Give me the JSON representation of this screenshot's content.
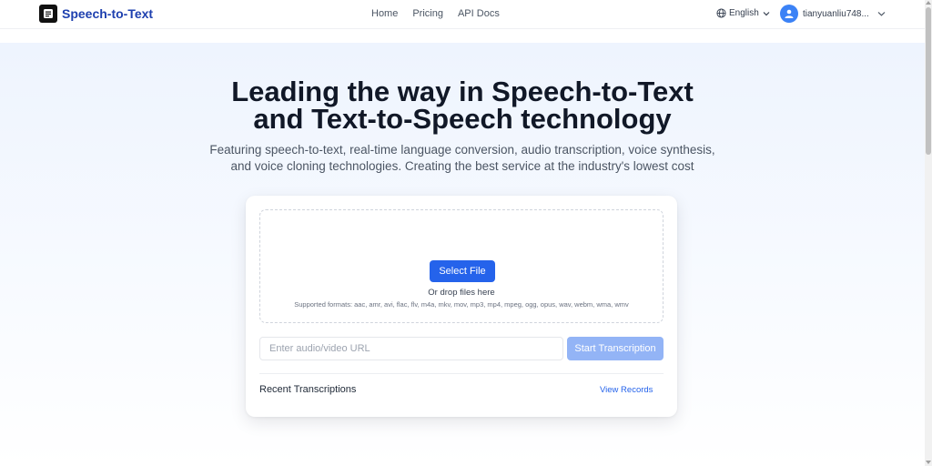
{
  "header": {
    "brand": "Speech-to-Text",
    "nav": [
      "Home",
      "Pricing",
      "API Docs"
    ],
    "language": "English",
    "username": "tianyuanliu748...",
    "brand_color": "#1e40af",
    "icons": {
      "logo": "app-logo-icon",
      "globe": "globe-icon",
      "avatar": "user-avatar-icon",
      "chevron": "chevron-down-icon"
    }
  },
  "hero": {
    "title_line1": "Leading the way in Speech-to-Text",
    "title_line2": "and Text-to-Speech technology",
    "subtitle_line1": "Featuring speech-to-text, real-time language conversion, audio transcription, voice synthesis,",
    "subtitle_line2": "and voice cloning technologies. Creating the best service at the industry's lowest cost"
  },
  "upload": {
    "select_button": "Select File",
    "drop_hint": "Or drop files here",
    "formats": "Supported formats: aac, amr, avi, flac, flv, m4a, mkv, mov, mp3, mp4, mpeg, ogg, opus, wav, webm, wma, wmv",
    "url_placeholder": "Enter audio/video URL",
    "start_button": "Start Transcription",
    "recent_label": "Recent Transcriptions",
    "view_records": "View Records",
    "accent_color": "#2563eb"
  }
}
